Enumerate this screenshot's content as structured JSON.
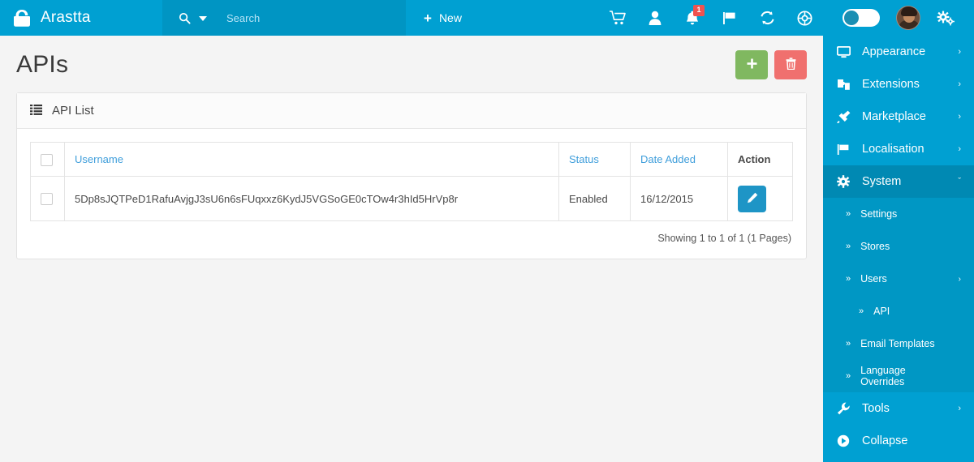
{
  "header": {
    "brand": {
      "logo_icon": "arastta-logo-icon",
      "name": "Arastta"
    },
    "search": {
      "icon": "search-icon",
      "dropdown_icon": "chevron-down-icon",
      "placeholder": "Search",
      "value": ""
    },
    "new_button": {
      "icon": "plus-icon",
      "label": "New"
    },
    "icons": [
      {
        "name": "cart-icon",
        "glyph": "🛒",
        "badge": ""
      },
      {
        "name": "user-icon",
        "glyph": "👤",
        "badge": ""
      },
      {
        "name": "bell-icon",
        "glyph": "🔔",
        "badge": "1"
      },
      {
        "name": "flag-icon",
        "glyph": "⚑",
        "badge": ""
      },
      {
        "name": "sync-icon",
        "glyph": "↻",
        "badge": ""
      },
      {
        "name": "globe-icon",
        "glyph": "⊕",
        "badge": ""
      }
    ],
    "toggle": {
      "name": "theme-toggle",
      "state": "off"
    },
    "avatar": {
      "name": "user-avatar"
    },
    "settings_icon": {
      "name": "gears-icon",
      "glyph": "⚙"
    }
  },
  "page": {
    "title": "APIs",
    "add_button": {
      "icon": "plus-icon",
      "label": "+"
    },
    "delete_button": {
      "icon": "trash-icon",
      "label": "🗑"
    }
  },
  "panel": {
    "icon": "list-icon",
    "title": "API List"
  },
  "table": {
    "columns": [
      {
        "key": "check",
        "label": "",
        "link": false
      },
      {
        "key": "username",
        "label": "Username",
        "link": true
      },
      {
        "key": "status",
        "label": "Status",
        "link": true
      },
      {
        "key": "date_added",
        "label": "Date Added",
        "link": true
      },
      {
        "key": "action",
        "label": "Action",
        "link": false
      }
    ],
    "rows": [
      {
        "username": "5Dp8sJQTPeD1RafuAvjgJ3sU6n6sFUqxxz6KydJ5VGSoGE0cTOw4r3hId5HrVp8r",
        "status": "Enabled",
        "date_added": "16/12/2015",
        "edit_icon": "pencil-icon"
      }
    ],
    "footer": "Showing 1 to 1 of 1 (1 Pages)"
  },
  "sidebar": {
    "items": [
      {
        "label": "Appearance",
        "icon": "monitor-icon",
        "glyph": "☐",
        "arrow": "›",
        "active": false
      },
      {
        "label": "Extensions",
        "icon": "puzzle-icon",
        "glyph": "❖",
        "arrow": "›",
        "active": false
      },
      {
        "label": "Marketplace",
        "icon": "plug-icon",
        "glyph": "✦",
        "arrow": "›",
        "active": false
      },
      {
        "label": "Localisation",
        "icon": "flag-icon",
        "glyph": "⚑",
        "arrow": "›",
        "active": false
      },
      {
        "label": "System",
        "icon": "gear-icon",
        "glyph": "⚙",
        "arrow": "ˇ",
        "active": true
      }
    ],
    "sub_items": [
      {
        "label": "Settings",
        "chevron": "»",
        "arrow": "",
        "deep": false,
        "active": false
      },
      {
        "label": "Stores",
        "chevron": "»",
        "arrow": "",
        "deep": false,
        "active": false
      },
      {
        "label": "Users",
        "chevron": "»",
        "arrow": "›",
        "deep": false,
        "active": false
      },
      {
        "label": "API",
        "chevron": "»",
        "arrow": "",
        "deep": true,
        "active": true
      },
      {
        "label": "Email Templates",
        "chevron": "»",
        "arrow": "",
        "deep": false,
        "active": false
      },
      {
        "label": "Language Overrides",
        "chevron": "»",
        "arrow": "",
        "deep": false,
        "active": false
      }
    ],
    "bottom_items": [
      {
        "label": "Tools",
        "icon": "wrench-icon",
        "glyph": "🔧",
        "arrow": "›"
      },
      {
        "label": "Collapse",
        "icon": "collapse-icon",
        "glyph": "▶",
        "arrow": ""
      }
    ]
  },
  "colors": {
    "header_blue": "#00a0d2",
    "header_search_blue": "#0095c3",
    "sidebar_blue": "#00a0d2",
    "sidebar_active": "#0089b3",
    "sidebar_sub": "#0097c4",
    "accent_link": "#3f9edb",
    "green": "#80b860",
    "red": "#f0706e",
    "edit_blue": "#1e95c6",
    "badge_red": "#ef5350"
  }
}
